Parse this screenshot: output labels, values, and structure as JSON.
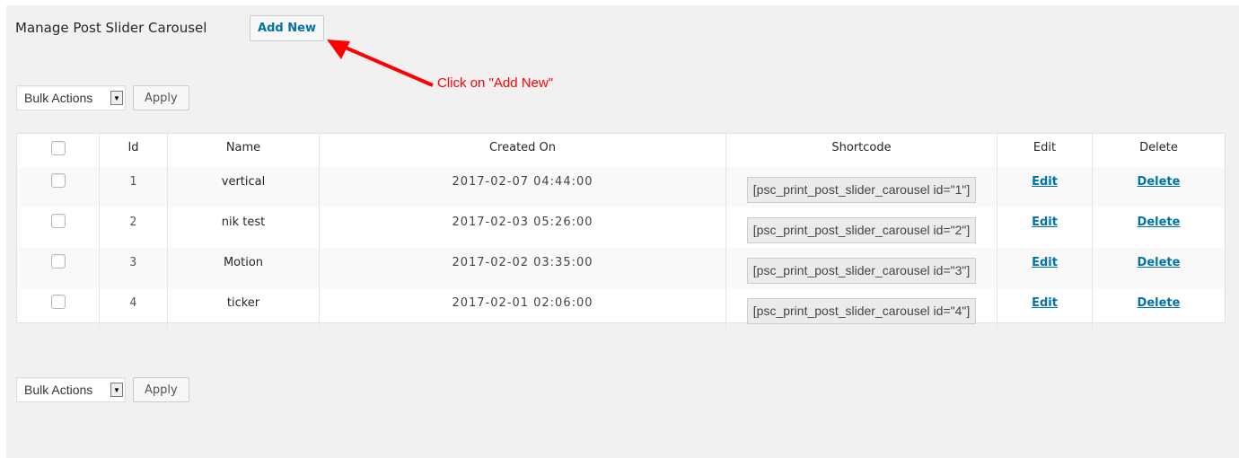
{
  "header": {
    "title": "Manage Post Slider Carousel",
    "add_new_label": "Add New"
  },
  "annotation": {
    "text": "Click on \"Add New\"",
    "color": "#ff0000"
  },
  "bulk_top": {
    "select_label": "Bulk Actions",
    "apply_label": "Apply"
  },
  "bulk_bottom": {
    "select_label": "Bulk Actions",
    "apply_label": "Apply"
  },
  "table": {
    "columns": [
      "Id",
      "Name",
      "Created On",
      "Shortcode",
      "Edit",
      "Delete"
    ],
    "rows": [
      {
        "id": "1",
        "name": "vertical",
        "created": "2017-02-07 04:44:00",
        "shortcode": "[psc_print_post_slider_carousel id=\"1\"]",
        "edit": "Edit",
        "delete": "Delete"
      },
      {
        "id": "2",
        "name": "nik test",
        "created": "2017-02-03 05:26:00",
        "shortcode": "[psc_print_post_slider_carousel id=\"2\"]",
        "edit": "Edit",
        "delete": "Delete"
      },
      {
        "id": "3",
        "name": "Motion",
        "created": "2017-02-02 03:35:00",
        "shortcode": "[psc_print_post_slider_carousel id=\"3\"]",
        "edit": "Edit",
        "delete": "Delete"
      },
      {
        "id": "4",
        "name": "ticker",
        "created": "2017-02-01 02:06:00",
        "shortcode": "[psc_print_post_slider_carousel id=\"4\"]",
        "edit": "Edit",
        "delete": "Delete"
      }
    ]
  },
  "colors": {
    "link": "#0073aa",
    "background": "#f1f1f1"
  }
}
